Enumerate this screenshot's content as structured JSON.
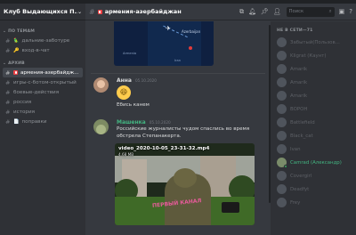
{
  "server": {
    "name": "Клуб Выдающихся П...",
    "chevron": "⌄"
  },
  "categories": [
    {
      "label": "ПО ТЕМАМ",
      "arrow": "⌄"
    },
    {
      "label": "АРХИВ",
      "arrow": "⌄"
    }
  ],
  "channels_topics": [
    {
      "label": "дальние-заботуре",
      "icon": "🦜",
      "active": false
    },
    {
      "label": "вход-в-чат",
      "icon": "🔑",
      "active": false
    }
  ],
  "channels_archive": [
    {
      "label": "армения-азербайдж...",
      "icon": "red-square",
      "active": true
    },
    {
      "label": "игры-с-ботом-открытый",
      "icon": "",
      "active": false
    },
    {
      "label": "боевые-действия",
      "icon": "",
      "active": false
    },
    {
      "label": "россия",
      "icon": "",
      "active": false
    },
    {
      "label": "история",
      "icon": "",
      "active": false
    },
    {
      "label": "поправки",
      "icon": "📄",
      "active": false
    }
  ],
  "topbar": {
    "channel": "армения-азербайджан",
    "search_placeholder": "Поиск",
    "icons": [
      "hash-icon",
      "threads-icon",
      "bell-icon",
      "pin-icon",
      "members-icon",
      "inbox-icon",
      "help-icon"
    ]
  },
  "map_embed": {
    "country_label": "Azerbaijan",
    "labels": [
      "Armenia",
      "Iran"
    ]
  },
  "messages": [
    {
      "author": "Анна",
      "author_color": "#dcddde",
      "time": "05.10.2020",
      "emoji": "😆",
      "text": "Ебись канем"
    },
    {
      "author": "Машенка",
      "author_color": "#43b581",
      "time": "05.10.2020",
      "text_lines": [
        "Российские журналисты чудом спаслись во время",
        "обстрела Степанакерта."
      ],
      "video": {
        "title": "video_2020-10-05_23-31-32.mp4",
        "size": "4.68 MB",
        "watermark": "ПЕРВЫЙ КАНАЛ"
      }
    }
  ],
  "member_list": {
    "category": "НЕ В СЕТИ—71",
    "members": [
      {
        "name": "Забытый(Пользов...",
        "online": false
      },
      {
        "name": "Kligrat (Каунт)",
        "online": false
      },
      {
        "name": "Amarik",
        "online": false
      },
      {
        "name": "Amarik",
        "online": false
      },
      {
        "name": "Amarik",
        "online": false
      },
      {
        "name": "BOPOH",
        "online": false
      },
      {
        "name": "Battlefield",
        "online": false
      },
      {
        "name": "Black_cat",
        "online": false
      },
      {
        "name": "Ivan",
        "online": false
      },
      {
        "name": "Camrad (Александр)",
        "online": true
      },
      {
        "name": "Covergirl",
        "online": false
      },
      {
        "name": "Deadfyt",
        "online": false
      },
      {
        "name": "Frey",
        "online": false
      }
    ]
  },
  "colors": {
    "accent_green": "#43b581",
    "active_channel_bg": "#42464d",
    "bg_main": "#36393f",
    "bg_side": "#2f3136"
  }
}
